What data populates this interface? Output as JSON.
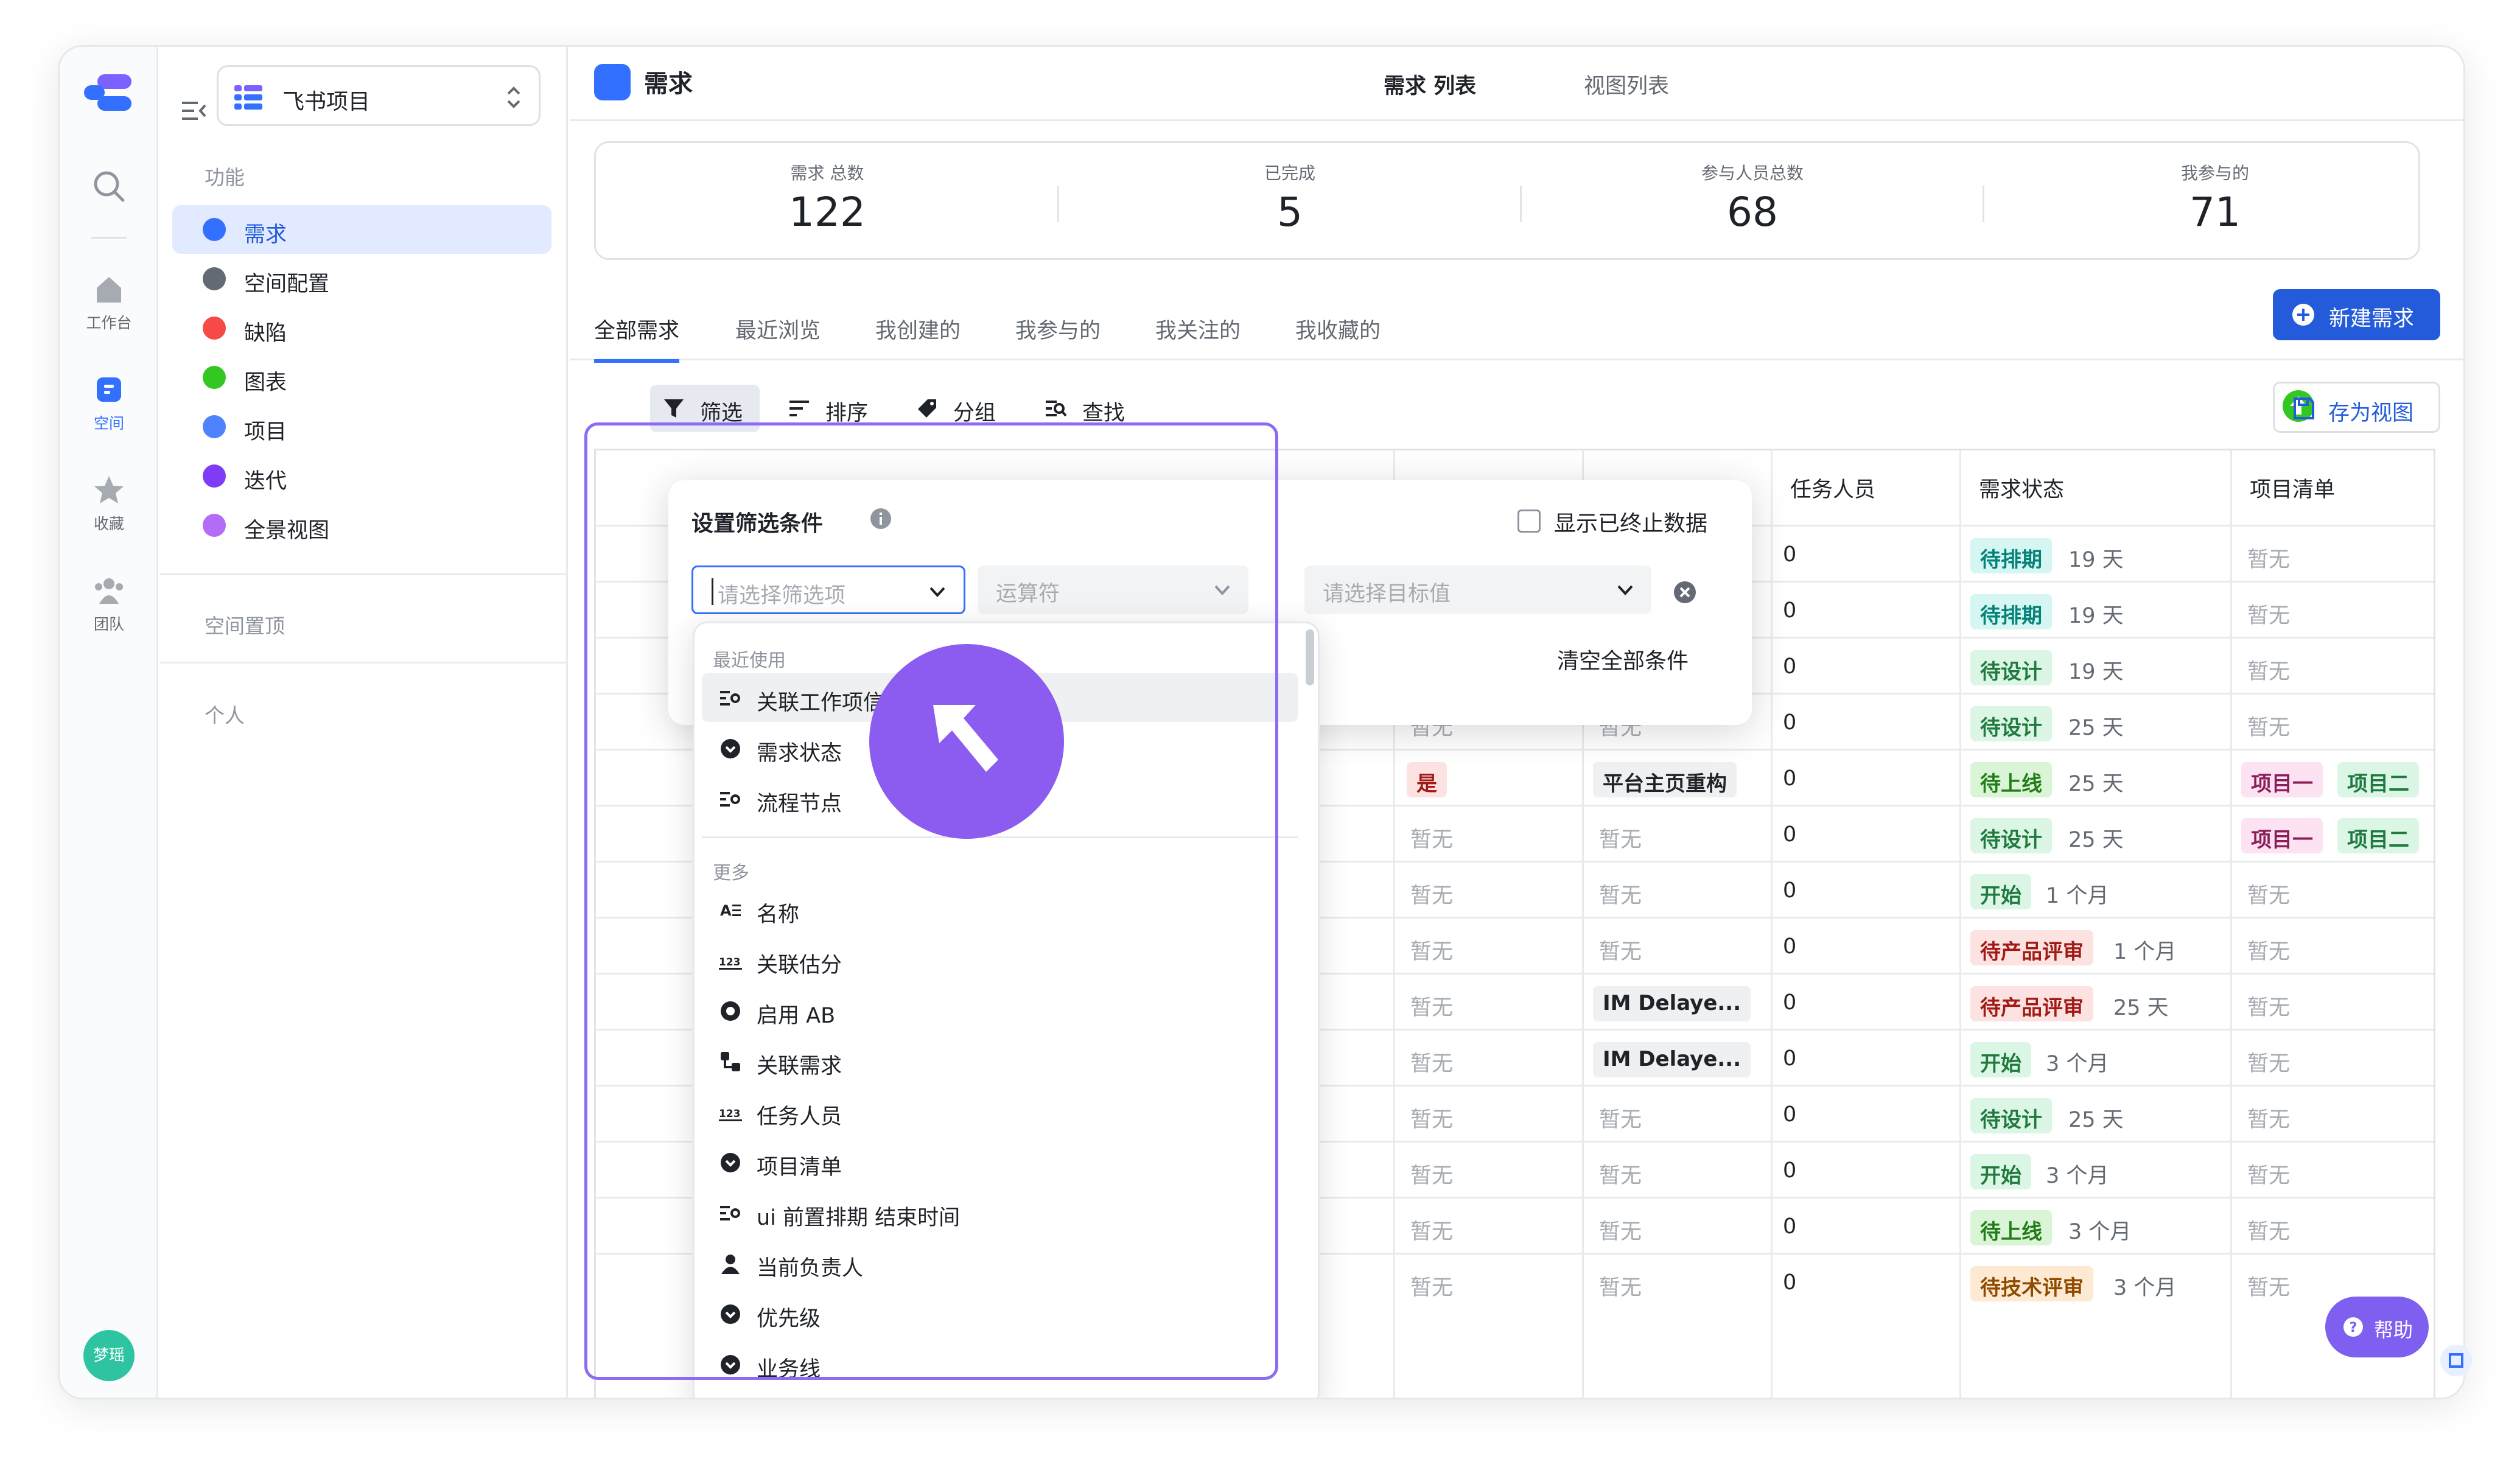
{
  "rail": {
    "items": [
      {
        "label": "工作台"
      },
      {
        "label": "空间"
      },
      {
        "label": "收藏"
      },
      {
        "label": "团队"
      }
    ],
    "avatar": "梦瑶"
  },
  "sidebar": {
    "space_name": "飞书项目",
    "section_features": "功能",
    "items": [
      {
        "label": "需求",
        "color": "#3370ff"
      },
      {
        "label": "空间配置",
        "color": "#646a73"
      },
      {
        "label": "缺陷",
        "color": "#f54a45"
      },
      {
        "label": "图表",
        "color": "#34c724"
      },
      {
        "label": "项目",
        "color": "#4e83fd"
      },
      {
        "label": "迭代",
        "color": "#7f3bf5"
      },
      {
        "label": "全景视图",
        "color": "#b26cf5"
      }
    ],
    "section_pinned": "空间置顶",
    "section_personal": "个人"
  },
  "header": {
    "title": "需求",
    "tabs": [
      {
        "label": "需求 列表"
      },
      {
        "label": "视图列表"
      }
    ]
  },
  "stats": [
    {
      "label": "需求 总数",
      "value": "122"
    },
    {
      "label": "已完成",
      "value": "5"
    },
    {
      "label": "参与人员总数",
      "value": "68"
    },
    {
      "label": "我参与的",
      "value": "71"
    }
  ],
  "view_tabs": [
    {
      "label": "全部需求"
    },
    {
      "label": "最近浏览"
    },
    {
      "label": "我创建的"
    },
    {
      "label": "我参与的"
    },
    {
      "label": "我关注的"
    },
    {
      "label": "我收藏的"
    }
  ],
  "new_button": "新建需求",
  "toolbar": {
    "filter": "筛选",
    "sort": "排序",
    "group": "分组",
    "find": "查找",
    "save_view": "存为视图"
  },
  "table": {
    "columns": [
      "任务人员",
      "需求状态",
      "项目清单"
    ],
    "rows": [
      {
        "c1": "",
        "c2": "",
        "assignee": "0",
        "status": "待排期",
        "dur": "19 天",
        "projects": [
          "暂无"
        ]
      },
      {
        "c1": "",
        "c2": "",
        "assignee": "0",
        "status": "待排期",
        "dur": "19 天",
        "projects": [
          "暂无"
        ]
      },
      {
        "c1": "",
        "c2": "",
        "assignee": "0",
        "status": "待设计",
        "dur": "19 天",
        "projects": [
          "暂无"
        ]
      },
      {
        "c1": "暂无",
        "c2": "暂无",
        "assignee": "0",
        "status": "待设计",
        "dur": "25 天",
        "projects": [
          "暂无"
        ]
      },
      {
        "c1": "是",
        "c2": "平台主页重构",
        "assignee": "0",
        "status": "待上线",
        "dur": "25 天",
        "projects": [
          "项目一",
          "项目二"
        ]
      },
      {
        "c1": "暂无",
        "c2": "暂无",
        "assignee": "0",
        "status": "待设计",
        "dur": "25 天",
        "projects": [
          "项目一",
          "项目二"
        ]
      },
      {
        "c1": "暂无",
        "c2": "暂无",
        "assignee": "0",
        "status": "开始",
        "dur": "1 个月",
        "projects": [
          "暂无"
        ]
      },
      {
        "c1": "暂无",
        "c2": "暂无",
        "assignee": "0",
        "status": "待产品评审",
        "dur": "1 个月",
        "projects": [
          "暂无"
        ]
      },
      {
        "c1": "暂无",
        "c2": "IM Delaye...",
        "assignee": "0",
        "status": "待产品评审",
        "dur": "25 天",
        "projects": [
          "暂无"
        ]
      },
      {
        "c1": "暂无",
        "c2": "IM Delaye...",
        "assignee": "0",
        "status": "开始",
        "dur": "3 个月",
        "projects": [
          "暂无"
        ]
      },
      {
        "c1": "暂无",
        "c2": "暂无",
        "assignee": "0",
        "status": "待设计",
        "dur": "25 天",
        "projects": [
          "暂无"
        ]
      },
      {
        "c1": "暂无",
        "c2": "暂无",
        "assignee": "0",
        "status": "开始",
        "dur": "3 个月",
        "projects": [
          "暂无"
        ]
      },
      {
        "c1": "暂无",
        "c2": "暂无",
        "assignee": "0",
        "status": "待上线",
        "dur": "3 个月",
        "projects": [
          "暂无"
        ]
      },
      {
        "c1": "暂无",
        "c2": "暂无",
        "assignee": "0",
        "status": "待技术评审",
        "dur": "3 个月",
        "projects": [
          "暂无"
        ]
      }
    ]
  },
  "filter_panel": {
    "title": "设置筛选条件",
    "show_terminated": "显示已终止数据",
    "field_placeholder": "请选择筛选项",
    "operator_placeholder": "运算符",
    "value_placeholder": "请选择目标值",
    "clear_all": "清空全部条件"
  },
  "dropdown": {
    "recent_label": "最近使用",
    "recent": [
      {
        "label": "关联工作项信息",
        "icon": "linked-fields-icon"
      },
      {
        "label": "需求状态",
        "icon": "status-select-icon"
      },
      {
        "label": "流程节点",
        "icon": "linked-fields-icon"
      }
    ],
    "more_label": "更多",
    "more": [
      {
        "label": "名称",
        "icon": "text-field-icon"
      },
      {
        "label": "关联估分",
        "icon": "number-field-icon"
      },
      {
        "label": "启用 AB",
        "icon": "radio-field-icon"
      },
      {
        "label": "关联需求",
        "icon": "relation-field-icon"
      },
      {
        "label": "任务人员",
        "icon": "number-field-icon"
      },
      {
        "label": "项目清单",
        "icon": "select-field-icon"
      },
      {
        "label": "ui 前置排期 结束时间",
        "icon": "linked-fields-icon"
      },
      {
        "label": "当前负责人",
        "icon": "person-field-icon"
      },
      {
        "label": "优先级",
        "icon": "select-field-icon"
      },
      {
        "label": "业务线",
        "icon": "select-field-icon"
      }
    ]
  },
  "help_button": "帮助",
  "colors": {
    "accent": "#3370ff",
    "primary_button": "#245bdb",
    "focus_frame": "#8b6cf2",
    "cursor": "#8c5cf0"
  }
}
